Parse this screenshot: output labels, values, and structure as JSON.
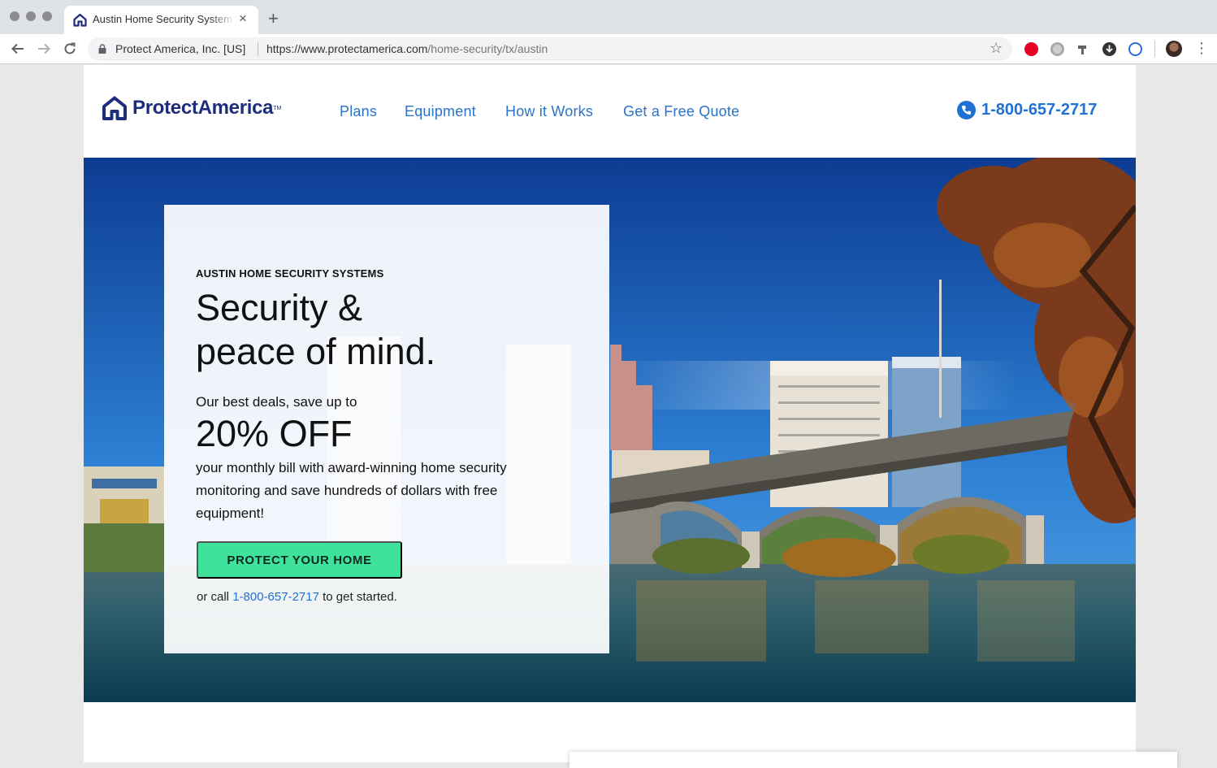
{
  "browser": {
    "tab_title": "Austin Home Security Systems",
    "tab_close": "×",
    "new_tab": "+",
    "site_identity": "Protect America, Inc. [US]",
    "url_host": "https://www.protectamerica.com",
    "url_path": "/home-security/tx/austin",
    "extension_colors": [
      "#e60023",
      "#bdbdbd",
      "#5f6368",
      "#333333",
      "#2a6fd6"
    ],
    "menu": "⋮"
  },
  "site": {
    "logo_text": "ProtectAmerica",
    "logo_tm": "TM",
    "nav": [
      "Plans",
      "Equipment",
      "How it Works",
      "Get a Free Quote"
    ],
    "phone": "1-800-657-2717",
    "brand_color": "#1d2d7c",
    "link_color": "#2a73c9",
    "cta_color": "#3ee29a"
  },
  "hero": {
    "eyebrow": "AUSTIN HOME SECURITY SYSTEMS",
    "headline_line1": "Security &",
    "headline_line2": "peace of mind.",
    "deal_lead": "Our best deals, save up to",
    "deal_big": "20% OFF",
    "deal_body": "your monthly bill with award-winning home security monitoring and save hundreds of dollars with free equipment!",
    "cta_label": "PROTECT YOUR HOME",
    "call_prefix": "or call ",
    "call_phone": "1-800-657-2717",
    "call_suffix": " to get started."
  }
}
